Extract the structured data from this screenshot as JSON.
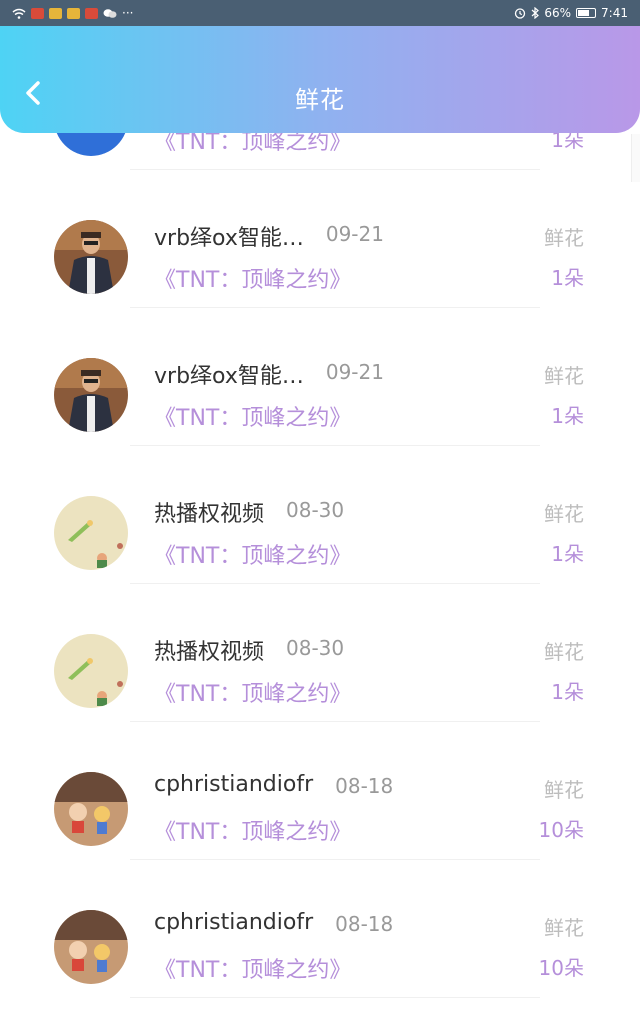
{
  "status_bar": {
    "right_text": "66%",
    "time": "7:41",
    "battery_level": 0.66
  },
  "header": {
    "title": "鲜花",
    "back_icon": "chevron-left-icon"
  },
  "list": [
    {
      "name": "",
      "date": "",
      "show": "《TNT：顶峰之约》",
      "kind": "",
      "qty": "1朵",
      "avatar_style": "blue"
    },
    {
      "name": "vrb绎ox智能…",
      "date": "09-21",
      "show": "《TNT：顶峰之约》",
      "kind": "鲜花",
      "qty": "1朵",
      "avatar_style": "man"
    },
    {
      "name": "vrb绎ox智能…",
      "date": "09-21",
      "show": "《TNT：顶峰之约》",
      "kind": "鲜花",
      "qty": "1朵",
      "avatar_style": "man"
    },
    {
      "name": "热播权视频",
      "date": "08-30",
      "show": "《TNT：顶峰之约》",
      "kind": "鲜花",
      "qty": "1朵",
      "avatar_style": "toy"
    },
    {
      "name": "热播权视频",
      "date": "08-30",
      "show": "《TNT：顶峰之约》",
      "kind": "鲜花",
      "qty": "1朵",
      "avatar_style": "toy"
    },
    {
      "name": "cphristiandiofr",
      "date": "08-18",
      "show": "《TNT：顶峰之约》",
      "kind": "鲜花",
      "qty": "10朵",
      "avatar_style": "figure"
    },
    {
      "name": "cphristiandiofr",
      "date": "08-18",
      "show": "《TNT：顶峰之约》",
      "kind": "鲜花",
      "qty": "10朵",
      "avatar_style": "figure"
    }
  ],
  "colors": {
    "accent": "#b58fda",
    "header_start": "#4ed3f4",
    "header_end": "#b998e8"
  }
}
